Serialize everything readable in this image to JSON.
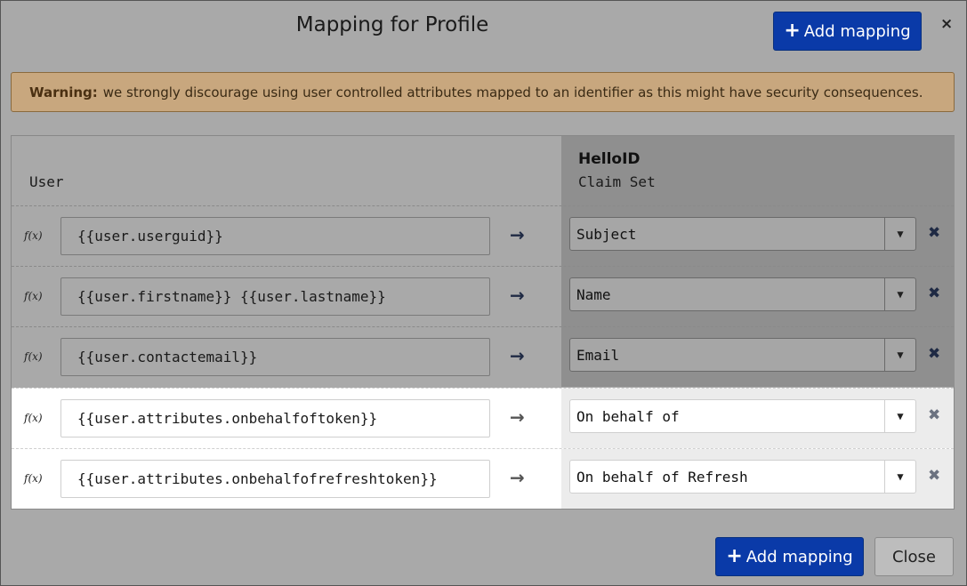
{
  "modal": {
    "title": "Mapping for Profile",
    "add_mapping_label": "Add mapping",
    "close_x": "×",
    "close_label": "Close"
  },
  "warning": {
    "prefix": "Warning:",
    "text": "we strongly discourage using user controlled attributes mapped to an identifier as this might have security consequences."
  },
  "table": {
    "left_header": "User",
    "right_header_title": "HelloID",
    "right_header_sub": "Claim Set",
    "rows": [
      {
        "fx": "f(x)",
        "source": "{{user.userguid}}",
        "arrow": "→",
        "claim": "Subject",
        "del": "✖"
      },
      {
        "fx": "f(x)",
        "source": "{{user.firstname}} {{user.lastname}}",
        "arrow": "→",
        "claim": "Name",
        "del": "✖"
      },
      {
        "fx": "f(x)",
        "source": "{{user.contactemail}}",
        "arrow": "→",
        "claim": "Email",
        "del": "✖"
      },
      {
        "fx": "f(x)",
        "source": "{{user.attributes.onbehalfoftoken}}",
        "arrow": "→",
        "claim": "On behalf of",
        "del": "✖"
      },
      {
        "fx": "f(x)",
        "source": "{{user.attributes.onbehalfofrefreshtoken}}",
        "arrow": "→",
        "claim": "On behalf of Refresh",
        "del": "✖"
      }
    ]
  },
  "colors": {
    "primary": "#0a3aa8",
    "warning_bg": "#c8a77e",
    "overlay": "#a9a9a9"
  }
}
